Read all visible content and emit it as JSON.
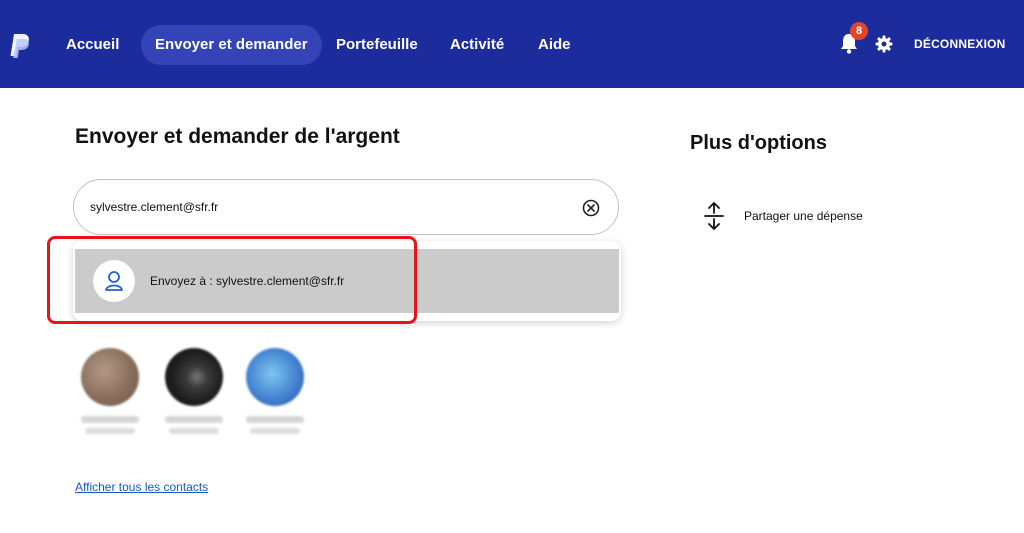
{
  "nav": {
    "items": [
      {
        "label": "Accueil",
        "active": false
      },
      {
        "label": "Envoyer et demander",
        "active": true
      },
      {
        "label": "Portefeuille",
        "active": false
      },
      {
        "label": "Activité",
        "active": false
      },
      {
        "label": "Aide",
        "active": false
      }
    ],
    "notification_count": "8",
    "logout_label": "DÉCONNEXION",
    "bar_color": "#1d2c9c",
    "active_pill_color": "#3444b6",
    "badge_color": "#e0462a"
  },
  "main": {
    "title": "Envoyer et demander de l'argent",
    "search": {
      "value": "sylvestre.clement@sfr.fr"
    },
    "suggestion": {
      "label": "Envoyez à : sylvestre.clement@sfr.fr",
      "icon": "user-icon"
    },
    "contacts": [
      {
        "avatar_colors": [
          "#8a6e5c",
          "#b39a86",
          "#6f5646"
        ]
      },
      {
        "avatar_colors": [
          "#1c1c1c",
          "#3a3a3a",
          "#777777"
        ]
      },
      {
        "avatar_colors": [
          "#4c8fd8",
          "#1f4fa8",
          "#7fc6ee"
        ]
      }
    ],
    "all_contacts_link": "Afficher tous les contacts"
  },
  "options": {
    "title": "Plus d'options",
    "items": [
      {
        "label": "Partager une dépense",
        "icon": "split-arrows-icon"
      }
    ]
  },
  "colors": {
    "link": "#1a56c8",
    "highlight": "#e8141a",
    "suggestion_bg": "#cbcbcb"
  }
}
